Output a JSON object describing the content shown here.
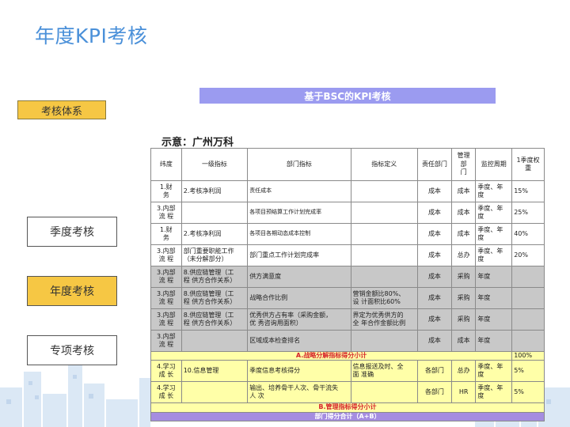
{
  "page": {
    "title": "年度KPI考核",
    "tab_system": "考核体系",
    "bsc_header": "基于BSC的KPI考核",
    "example_label": "示意：广州万科"
  },
  "sidebar": {
    "items": [
      {
        "label": "季度考核",
        "active": false
      },
      {
        "label": "年度考核",
        "active": true
      },
      {
        "label": "专项考核",
        "active": false
      }
    ]
  },
  "table": {
    "headers": [
      "纬度",
      "一级指标",
      "部门指标",
      "指标定义",
      "责任部门",
      "管理部门",
      "监控周期",
      "1季度权重"
    ],
    "header_display": {
      "manage_dept": [
        "管理",
        "部",
        "门"
      ],
      "weight": [
        "1季度权",
        "重"
      ]
    },
    "rows": [
      {
        "style": "white",
        "dim": "1.财\n务",
        "level1": "2.考核净利润",
        "dept": "责任成本",
        "definition": "",
        "resp": "成本",
        "manage": "成本",
        "period": "季度、年\n度",
        "weight": "15%"
      },
      {
        "style": "white",
        "dim": "3.内部\n流 程",
        "level1": "",
        "dept": "各项目预结算工作计划完成率",
        "definition": "",
        "resp": "成本",
        "manage": "成本",
        "period": "季度、年\n度",
        "weight": "25%"
      },
      {
        "style": "white",
        "dim": "1.财\n务",
        "level1": "2.考核净利润",
        "dept": "各项目各期动态成本控制",
        "definition": "",
        "resp": "成本",
        "manage": "成本",
        "period": "季度、年\n度",
        "weight": "40%"
      },
      {
        "style": "white",
        "dim": "3.内部\n流 程",
        "level1": "部门重要职能工作\n（未分解部分）",
        "dept": "部门重点工作计划完成率",
        "definition": "",
        "resp": "成本",
        "manage": "总办",
        "period": "季度、年\n度",
        "weight": "20%"
      },
      {
        "style": "gray",
        "dim": "3.内部\n流 程",
        "level1": "8.供应链管理（工\n程 供方合作关系）",
        "dept": "供方满意度",
        "definition": "",
        "resp": "成本",
        "manage": "采购",
        "period": "年度",
        "weight": ""
      },
      {
        "style": "gray",
        "dim": "3.内部\n流 程",
        "level1": "8.供应链管理（工\n程 供方合作关系）",
        "dept": "战略合作比例",
        "definition": "营销金额比80%、\n设 计面积比60%",
        "resp": "成本",
        "manage": "采购",
        "period": "年度",
        "weight": ""
      },
      {
        "style": "gray",
        "dim": "3.内部\n流 程",
        "level1": "8.供应链管理（工\n程 供方合作关系）",
        "dept": "优秀供方占有率（采购金额，\n优 秀咨询用面积）",
        "definition": "界定为优秀供方的\n全 年合作金额比例",
        "resp": "成本",
        "manage": "采购",
        "period": "年度",
        "weight": ""
      },
      {
        "style": "gray",
        "dim": "3.内部\n流 程",
        "level1": "",
        "dept": "区域成本检查排名",
        "definition": "",
        "resp": "成本",
        "manage": "成本",
        "period": "年度",
        "weight": ""
      }
    ],
    "summary_a": {
      "label": "A.战略分解指标得分小计",
      "weight": "100%"
    },
    "rows_b": [
      {
        "style": "yellow",
        "dim": "4.学习\n成 长",
        "level1": "10.信息管理",
        "dept": "季度信息考核得分",
        "definition": "信息报送及时、全\n面 准确",
        "resp": "各部门",
        "manage": "总办",
        "period": "季度、年\n度",
        "weight": "5%"
      },
      {
        "style": "yellow",
        "dim": "4.学习\n成 长",
        "level1": "",
        "dept": "输出、培养骨干人次、骨干流失\n人 次",
        "definition": "",
        "resp": "各部门",
        "manage": "HR",
        "period": "季度、年\n度",
        "weight": "5%"
      }
    ],
    "summary_b": {
      "label": "B.管理指标得分小计"
    },
    "summary_total": {
      "label": "部门得分合计（A+B）"
    }
  },
  "colors": {
    "title": "#4a90d9",
    "accent_yellow": "#f6c744",
    "bsc_purple": "#9b9bf0",
    "row_gray": "#c8c8c8",
    "row_yellow": "#ffffa8",
    "summary_red": "#d6232a",
    "total_purple": "#a58de0"
  }
}
